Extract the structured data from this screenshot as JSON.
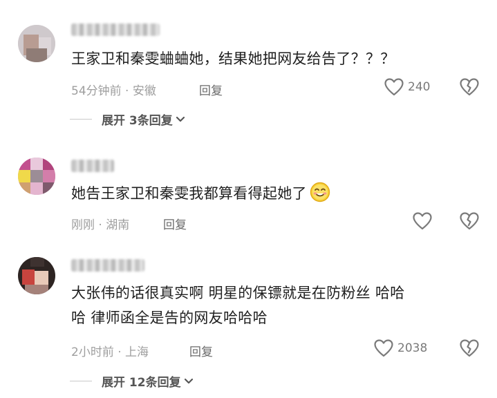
{
  "comments": [
    {
      "username": "",
      "text": "王家卫和秦雯蛐蛐她，结果她把网友给告了？？？",
      "time": "54分钟前",
      "location": "安徽",
      "reply_label": "回复",
      "like_count": "240",
      "expand_label": "展开 3条回复"
    },
    {
      "username": "",
      "text": "她告王家卫和秦雯我都算看得起她了",
      "time": "刚刚",
      "location": "湖南",
      "reply_label": "回复",
      "like_count": "",
      "emoji": "smile-emoji"
    },
    {
      "username": "",
      "text_line1": "大张伟的话很真实啊 明星的保镖就是在防粉丝 哈哈",
      "text_line2": "哈 律师函全是告的网友哈哈哈",
      "time": "2小时前",
      "location": "上海",
      "reply_label": "回复",
      "like_count": "2038",
      "expand_label": "展开 12条回复"
    }
  ],
  "separator": " · ",
  "icons": {
    "like": "heart-outline-icon",
    "dislike": "broken-heart-icon",
    "expand": "chevron-down-icon"
  },
  "colors": {
    "text": "#1f1f1f",
    "meta": "#9e9e9e",
    "icon": "#7a7a7a"
  }
}
